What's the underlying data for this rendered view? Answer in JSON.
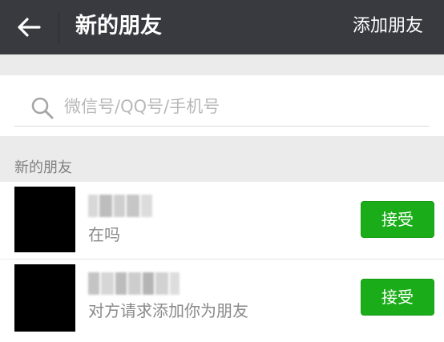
{
  "header": {
    "title": "新的朋友",
    "action_label": "添加朋友",
    "back_icon": "arrow-left-icon"
  },
  "search": {
    "placeholder": "微信号/QQ号/手机号",
    "value": "",
    "icon": "search-icon"
  },
  "section": {
    "title": "新的朋友"
  },
  "friends": [
    {
      "message": "在吗",
      "button_label": "接受"
    },
    {
      "message": "对方请求添加你为朋友",
      "button_label": "接受"
    }
  ],
  "colors": {
    "titlebar": "#393a3f",
    "accept": "#1aad19",
    "background": "#ebebeb"
  }
}
